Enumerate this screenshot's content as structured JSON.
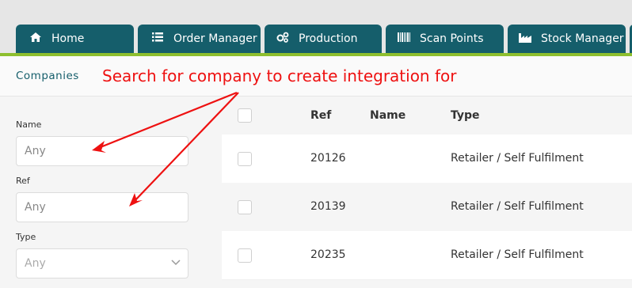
{
  "tabs": [
    {
      "label": "Home",
      "icon": "home-icon"
    },
    {
      "label": "Order Manager",
      "icon": "list-icon"
    },
    {
      "label": "Production",
      "icon": "gears-icon"
    },
    {
      "label": "Scan Points",
      "icon": "barcode-icon"
    },
    {
      "label": "Stock Manager",
      "icon": "factory-icon"
    }
  ],
  "breadcrumb": "Companies",
  "annotation": "Search for company to create integration for",
  "filters": {
    "name_label": "Name",
    "name_placeholder": "Any",
    "ref_label": "Ref",
    "ref_placeholder": "Any",
    "type_label": "Type",
    "type_value": "Any"
  },
  "table": {
    "headers": [
      "Ref",
      "Name",
      "Type"
    ],
    "rows": [
      {
        "ref": "20126",
        "name": "",
        "type": "Retailer / Self Fulfilment"
      },
      {
        "ref": "20139",
        "name": "",
        "type": "Retailer / Self Fulfilment"
      },
      {
        "ref": "20235",
        "name": "",
        "type": "Retailer / Self Fulfilment"
      }
    ]
  },
  "colors": {
    "tab": "#155e6b",
    "accent": "#8dbf2e",
    "annotation": "#ee1111"
  }
}
